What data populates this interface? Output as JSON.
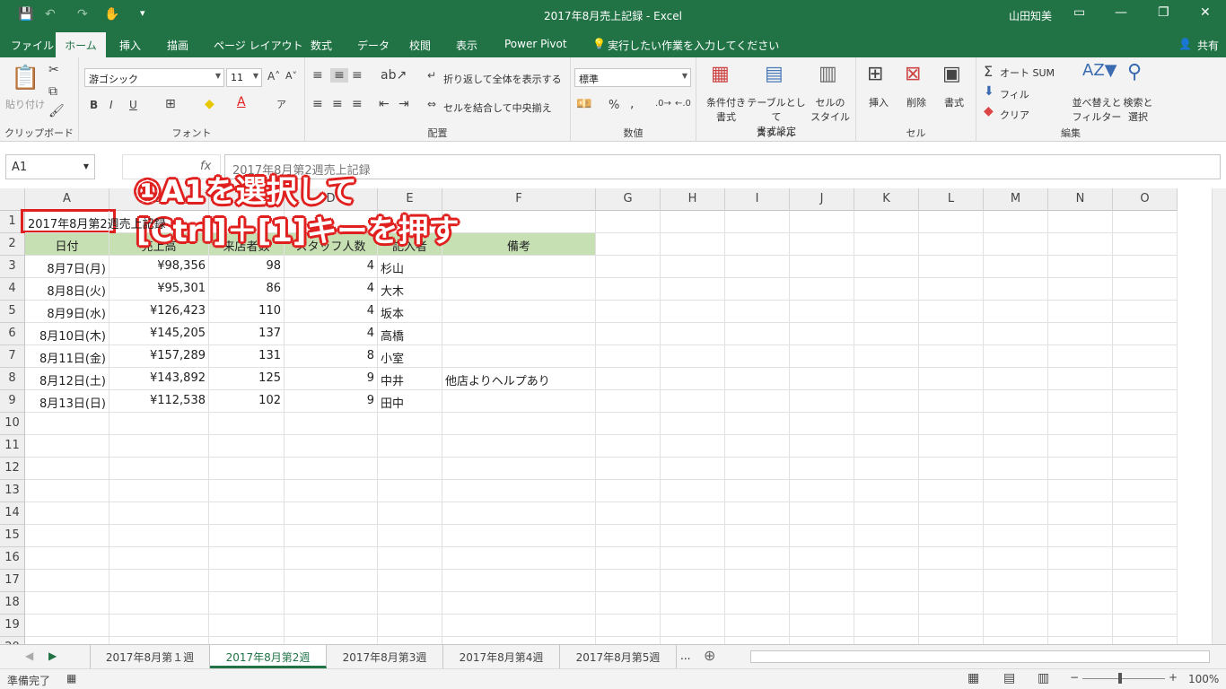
{
  "window": {
    "title": "2017年8月売上記録  -  Excel",
    "user": "山田知美",
    "share": "共有",
    "min": "—",
    "restore": "❐",
    "close": "✕",
    "ribbon_opt": "▭"
  },
  "qat": {
    "save": "💾",
    "undo": "↶",
    "redo": "↷",
    "touch": "✋",
    "customize": "▾"
  },
  "tabs": [
    "ファイル",
    "ホーム",
    "挿入",
    "描画",
    "ページ レイアウト",
    "数式",
    "データ",
    "校閲",
    "表示",
    "Power Pivot"
  ],
  "tell_me": "実行したい作業を入力してください",
  "ribbon": {
    "clipboard": {
      "label": "クリップボード",
      "paste": "貼り付け"
    },
    "font": {
      "label": "フォント",
      "name": "游ゴシック",
      "size": "11",
      "bold": "B",
      "italic": "I",
      "underline": "U"
    },
    "alignment": {
      "label": "配置",
      "wrap": "折り返して全体を表示する",
      "merge": "セルを結合して中央揃え"
    },
    "number": {
      "label": "数値",
      "format": "標準",
      "percent": "%",
      "comma": ","
    },
    "styles": {
      "label": "スタイル",
      "conditional": "条件付き\n書式",
      "table": "テーブルとして\n書式設定",
      "cellstyle": "セルの\nスタイル"
    },
    "cells": {
      "label": "セル",
      "insert": "挿入",
      "delete": "削除",
      "format": "書式"
    },
    "editing": {
      "label": "編集",
      "autosum": "オート SUM",
      "fill": "フィル",
      "clear": "クリア",
      "sort": "並べ替えと\nフィルター",
      "find": "検索と\n選択"
    }
  },
  "formula_bar": {
    "name_box": "A1",
    "fx": "fx",
    "content": "2017年8月第2週売上記録"
  },
  "columns": [
    "A",
    "B",
    "C",
    "D",
    "E",
    "F",
    "G",
    "H",
    "I",
    "J",
    "K",
    "L",
    "M",
    "N",
    "O"
  ],
  "rows": [
    "1",
    "2",
    "3",
    "4",
    "5",
    "6",
    "7",
    "8",
    "9",
    "10",
    "11",
    "12",
    "13",
    "14",
    "15",
    "16",
    "17",
    "18",
    "19",
    "20"
  ],
  "cells": {
    "a1": "2017年8月第2週売上記録",
    "headers": [
      "日付",
      "売上高",
      "来店者数",
      "スタッフ人数",
      "記入者",
      "備考"
    ],
    "data": [
      [
        "8月7日(月)",
        "¥98,356",
        "98",
        "4",
        "杉山",
        ""
      ],
      [
        "8月8日(火)",
        "¥95,301",
        "86",
        "4",
        "大木",
        ""
      ],
      [
        "8月9日(水)",
        "¥126,423",
        "110",
        "4",
        "坂本",
        ""
      ],
      [
        "8月10日(木)",
        "¥145,205",
        "137",
        "4",
        "高橋",
        ""
      ],
      [
        "8月11日(金)",
        "¥157,289",
        "131",
        "8",
        "小室",
        ""
      ],
      [
        "8月12日(土)",
        "¥143,892",
        "125",
        "9",
        "中井",
        "他店よりヘルプあり"
      ],
      [
        "8月13日(日)",
        "¥112,538",
        "102",
        "9",
        "田中",
        ""
      ]
    ]
  },
  "sheet_tabs": [
    "2017年8月第１週",
    "2017年8月第2週",
    "2017年8月第3週",
    "2017年8月第4週",
    "2017年8月第5週"
  ],
  "sheet_more": "...",
  "status": {
    "ready": "準備完了",
    "zoom": "100%"
  },
  "annotation": {
    "line1": "①A1を選択して",
    "line2": "[Ctrl]＋[1]キーを押す"
  },
  "colors": {
    "excel_green": "#217346",
    "header_fill": "#c6e0b4",
    "annotation_red": "#e0201e"
  }
}
